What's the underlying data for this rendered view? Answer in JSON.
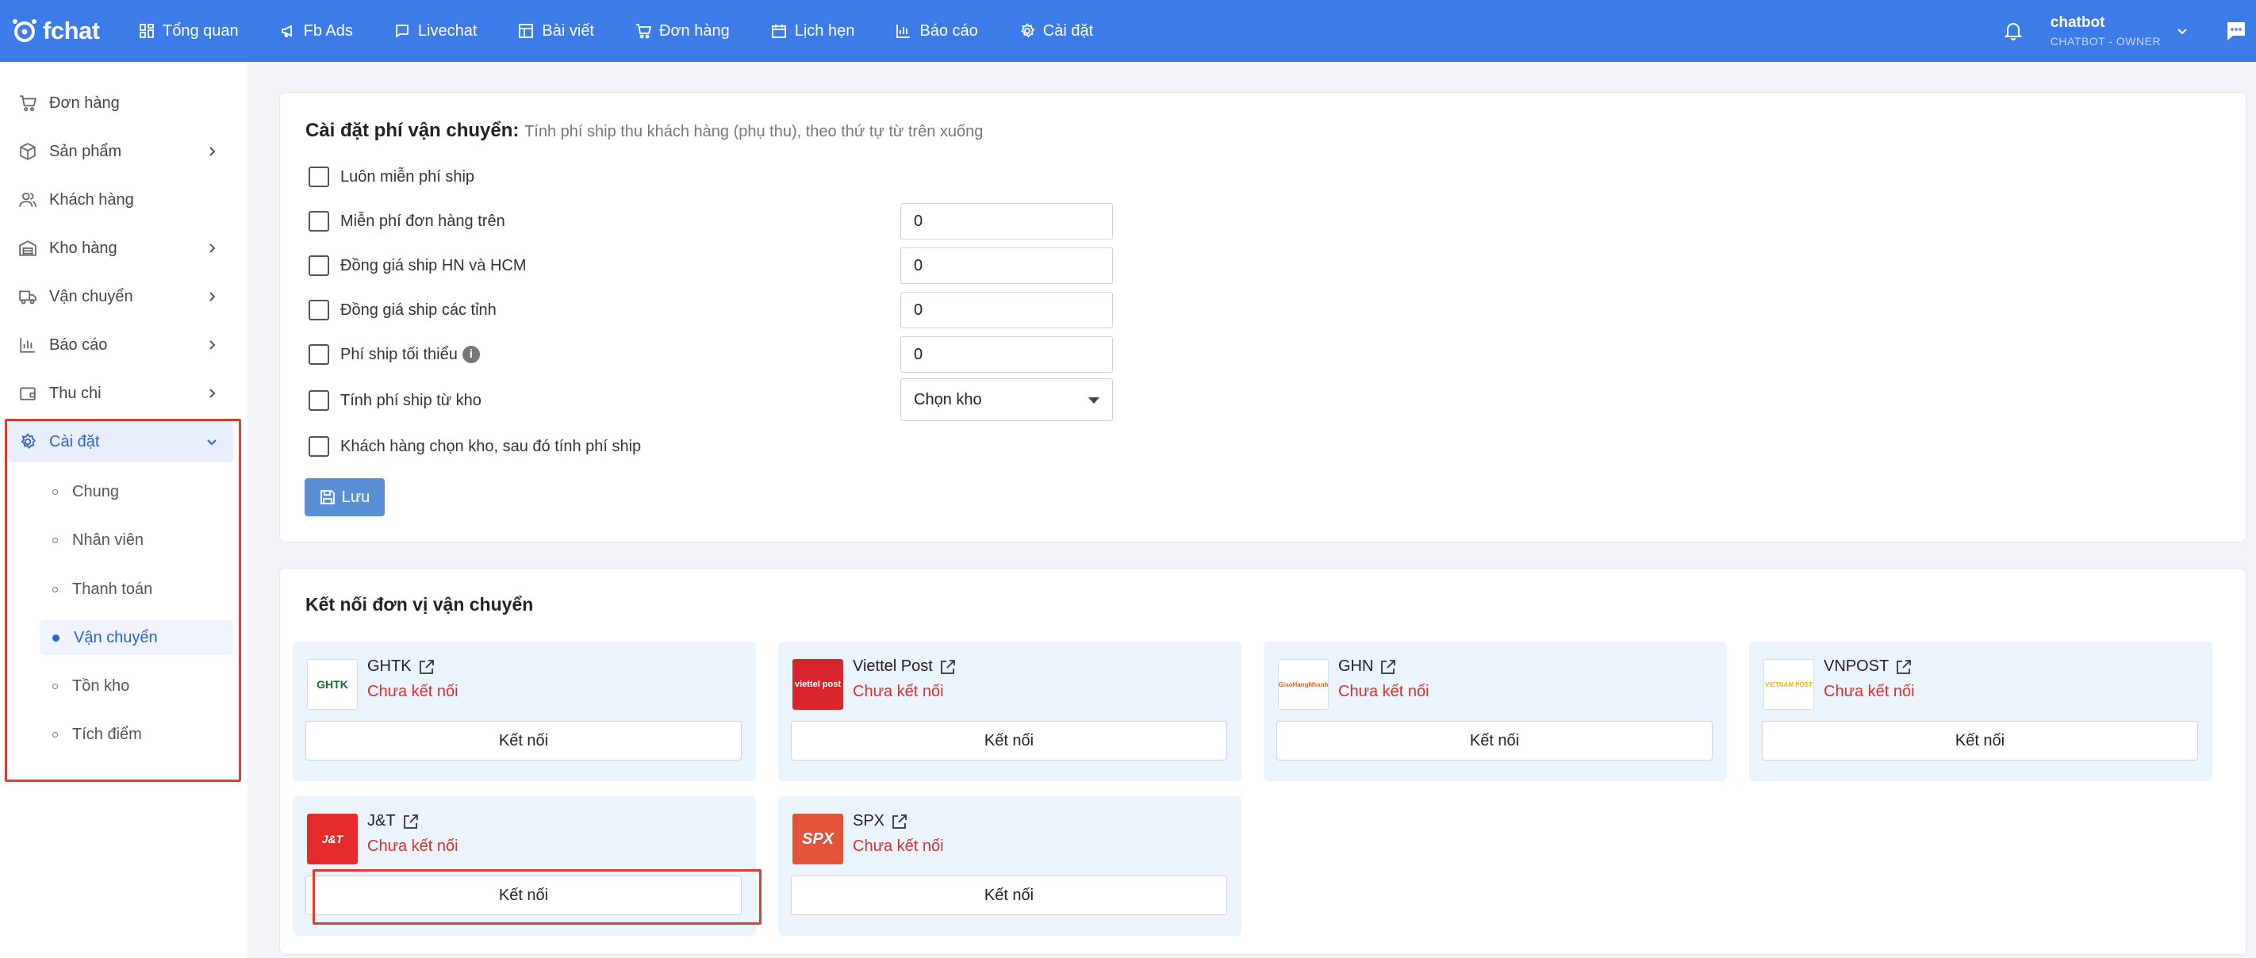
{
  "topbar": {
    "logo_text": "fchat",
    "nav": [
      {
        "label": "Tổng quan",
        "icon": "dashboard-icon"
      },
      {
        "label": "Fb Ads",
        "icon": "megaphone-icon"
      },
      {
        "label": "Livechat",
        "icon": "chat-icon"
      },
      {
        "label": "Bài viết",
        "icon": "layout-icon"
      },
      {
        "label": "Đơn hàng",
        "icon": "cart-icon"
      },
      {
        "label": "Lịch hẹn",
        "icon": "calendar-icon"
      },
      {
        "label": "Báo cáo",
        "icon": "bar-chart-icon"
      },
      {
        "label": "Cài đặt",
        "icon": "gear-icon"
      }
    ],
    "user_name": "chatbot",
    "user_role": "CHATBOT - OWNER"
  },
  "sidebar": {
    "items": [
      {
        "label": "Đơn hàng",
        "icon": "cart-icon"
      },
      {
        "label": "Sản phẩm",
        "icon": "box-icon"
      },
      {
        "label": "Khách hàng",
        "icon": "users-icon"
      },
      {
        "label": "Kho hàng",
        "icon": "warehouse-icon"
      },
      {
        "label": "Vận chuyển",
        "icon": "truck-icon"
      },
      {
        "label": "Báo cáo",
        "icon": "bar-chart-icon"
      },
      {
        "label": "Thu chi",
        "icon": "wallet-icon"
      },
      {
        "label": "Cài đặt",
        "icon": "gear-icon"
      }
    ],
    "sub_items": [
      "Chung",
      "Nhân viên",
      "Thanh toán",
      "Vận chuyển",
      "Tồn kho",
      "Tích điểm"
    ],
    "active_sub": "Vận chuyển"
  },
  "shipping_fee": {
    "title": "Cài đặt phí vận chuyển:",
    "hint": "Tính phí ship thu khách hàng (phụ thu), theo thứ tự từ trên xuống",
    "options": [
      {
        "label": "Luôn miễn phí ship",
        "value": ""
      },
      {
        "label": "Miễn phí đơn hàng trên",
        "value": "0"
      },
      {
        "label": "Đồng giá ship HN và HCM",
        "value": "0"
      },
      {
        "label": "Đồng giá ship các tỉnh",
        "value": "0"
      },
      {
        "label": "Phí ship tối thiểu",
        "value": "0"
      },
      {
        "label": "Tính phí ship từ kho",
        "value": "Chọn kho"
      },
      {
        "label": "Khách hàng chọn kho, sau đó tính phí ship",
        "value": ""
      }
    ],
    "save_label": "Lưu"
  },
  "carriers": {
    "title": "Kết nối đơn vị vận chuyển",
    "status_text": "Chưa kết nối",
    "connect_label": "Kết nối",
    "list": [
      {
        "name": "GHTK",
        "logo_text": "GHTK",
        "logo_bg": "#ffffff",
        "logo_fg": "#1b6b2f"
      },
      {
        "name": "Viettel Post",
        "logo_text": "viettel post",
        "logo_bg": "#d8262c",
        "logo_fg": "#ffffff"
      },
      {
        "name": "GHN",
        "logo_text": "GiaoHangNhanh",
        "logo_bg": "#ffffff",
        "logo_fg": "#f26522"
      },
      {
        "name": "VNPOST",
        "logo_text": "VIETNAM POST",
        "logo_bg": "#ffffff",
        "logo_fg": "#f4b400"
      },
      {
        "name": "J&T",
        "logo_text": "J&T",
        "logo_bg": "#e52b2b",
        "logo_fg": "#ffffff"
      },
      {
        "name": "SPX",
        "logo_text": "SPX",
        "logo_bg": "#e0543a",
        "logo_fg": "#ffffff"
      }
    ]
  },
  "colors": {
    "primary": "#3d7be8",
    "status_red": "#d9302c",
    "highlight_box": "#dc3f2e"
  }
}
